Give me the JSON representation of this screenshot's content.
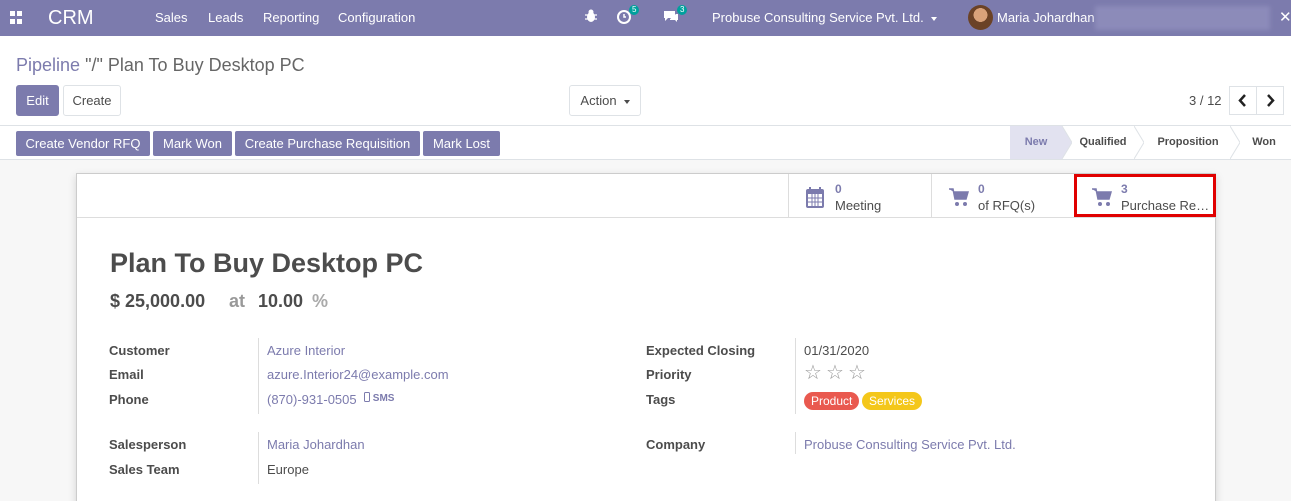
{
  "navbar": {
    "brand": "CRM",
    "menu": [
      "Sales",
      "Leads",
      "Reporting",
      "Configuration"
    ],
    "activities_count": "5",
    "messages_count": "3",
    "company": "Probuse Consulting Service Pvt. Ltd.",
    "user": "Maria Johardhan"
  },
  "breadcrumb": {
    "parent": "Pipeline",
    "separator": "\"/\"",
    "current": "Plan To Buy Desktop PC"
  },
  "buttons": {
    "edit": "Edit",
    "create": "Create",
    "action": "Action"
  },
  "pager": {
    "value": "3 / 12"
  },
  "status_buttons": [
    "Create Vendor RFQ",
    "Mark Won",
    "Create Purchase Requisition",
    "Mark Lost"
  ],
  "stages": [
    "New",
    "Qualified",
    "Proposition",
    "Won"
  ],
  "active_stage": "New",
  "smart_buttons": [
    {
      "count": "0",
      "label": "Meeting",
      "icon": "calendar-icon"
    },
    {
      "count": "0",
      "label": "of RFQ(s)",
      "icon": "cart-icon"
    },
    {
      "count": "3",
      "label": "Purchase Requisitions",
      "icon": "cart-icon"
    }
  ],
  "record": {
    "title": "Plan To Buy Desktop PC",
    "revenue": "$ 25,000.00",
    "at": "at",
    "probability": "10.00",
    "percent": "%"
  },
  "fields": {
    "customer_label": "Customer",
    "customer": "Azure Interior",
    "email_label": "Email",
    "email": "azure.Interior24@example.com",
    "phone_label": "Phone",
    "phone": "(870)-931-0505",
    "sms": "SMS",
    "salesperson_label": "Salesperson",
    "salesperson": "Maria Johardhan",
    "sales_team_label": "Sales Team",
    "sales_team": "Europe",
    "expected_closing_label": "Expected Closing",
    "expected_closing": "01/31/2020",
    "priority_label": "Priority",
    "priority_stars": 0,
    "priority_max": 3,
    "tags_label": "Tags",
    "tags": [
      {
        "name": "Product",
        "color": "#e9594f"
      },
      {
        "name": "Services",
        "color": "#f4c71a"
      }
    ],
    "company_label": "Company",
    "company": "Probuse Consulting Service Pvt. Ltd."
  },
  "colors": {
    "brand": "#7c7bad",
    "highlight": "#e00000"
  }
}
